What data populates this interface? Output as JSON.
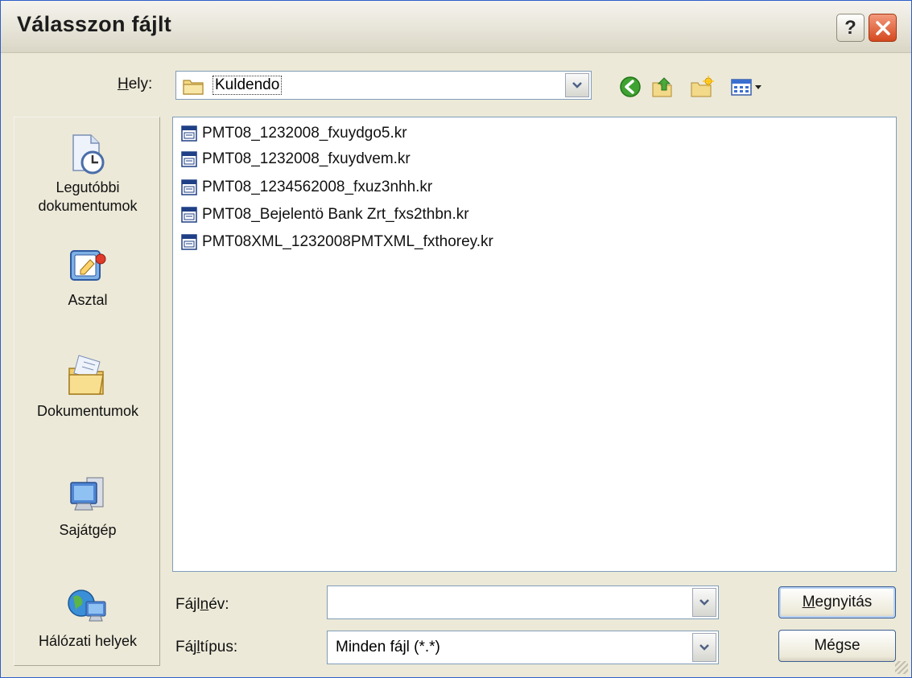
{
  "window": {
    "title": "Válasszon fájlt",
    "help_glyph": "?",
    "close_icon": "close-icon"
  },
  "location": {
    "label_prefix": "",
    "label_accel": "H",
    "label_rest": "ely:",
    "value": "Kuldendo"
  },
  "toolbar": {
    "icons": [
      "back-icon",
      "up-folder-icon",
      "new-folder-icon",
      "view-menu-icon"
    ]
  },
  "places": [
    {
      "label": "Legutóbbi dokumentumok",
      "icon": "recent-documents-icon"
    },
    {
      "label": "Asztal",
      "icon": "desktop-icon"
    },
    {
      "label": "Dokumentumok",
      "icon": "my-documents-icon"
    },
    {
      "label": "Sajátgép",
      "icon": "my-computer-icon"
    },
    {
      "label": "Hálózati helyek",
      "icon": "network-places-icon"
    }
  ],
  "files": [
    "PMT08_1232008_fxuydgo5.kr",
    "PMT08_1232008_fxuydvem.kr",
    "PMT08_1234562008_fxuz3nhh.kr",
    "PMT08_Bejelentö Bank Zrt_fxs2thbn.kr",
    "PMT08XML_1232008PMTXML_fxthorey.kr"
  ],
  "filename": {
    "label_prefix": "Fájl",
    "label_accel": "n",
    "label_rest": "év:",
    "value": ""
  },
  "filetype": {
    "label_prefix": "Fáj",
    "label_accel": "l",
    "label_rest": "típus:",
    "value": "Minden fájl (*.*)"
  },
  "buttons": {
    "open_accel": "M",
    "open_rest": "egnyitás",
    "cancel_prefix": "Mé",
    "cancel_accel": "g",
    "cancel_rest": "se"
  },
  "colors": {
    "title_border": "#2d5ec9",
    "dialog_bg": "#ece9d8",
    "close_red": "#d4481f"
  }
}
